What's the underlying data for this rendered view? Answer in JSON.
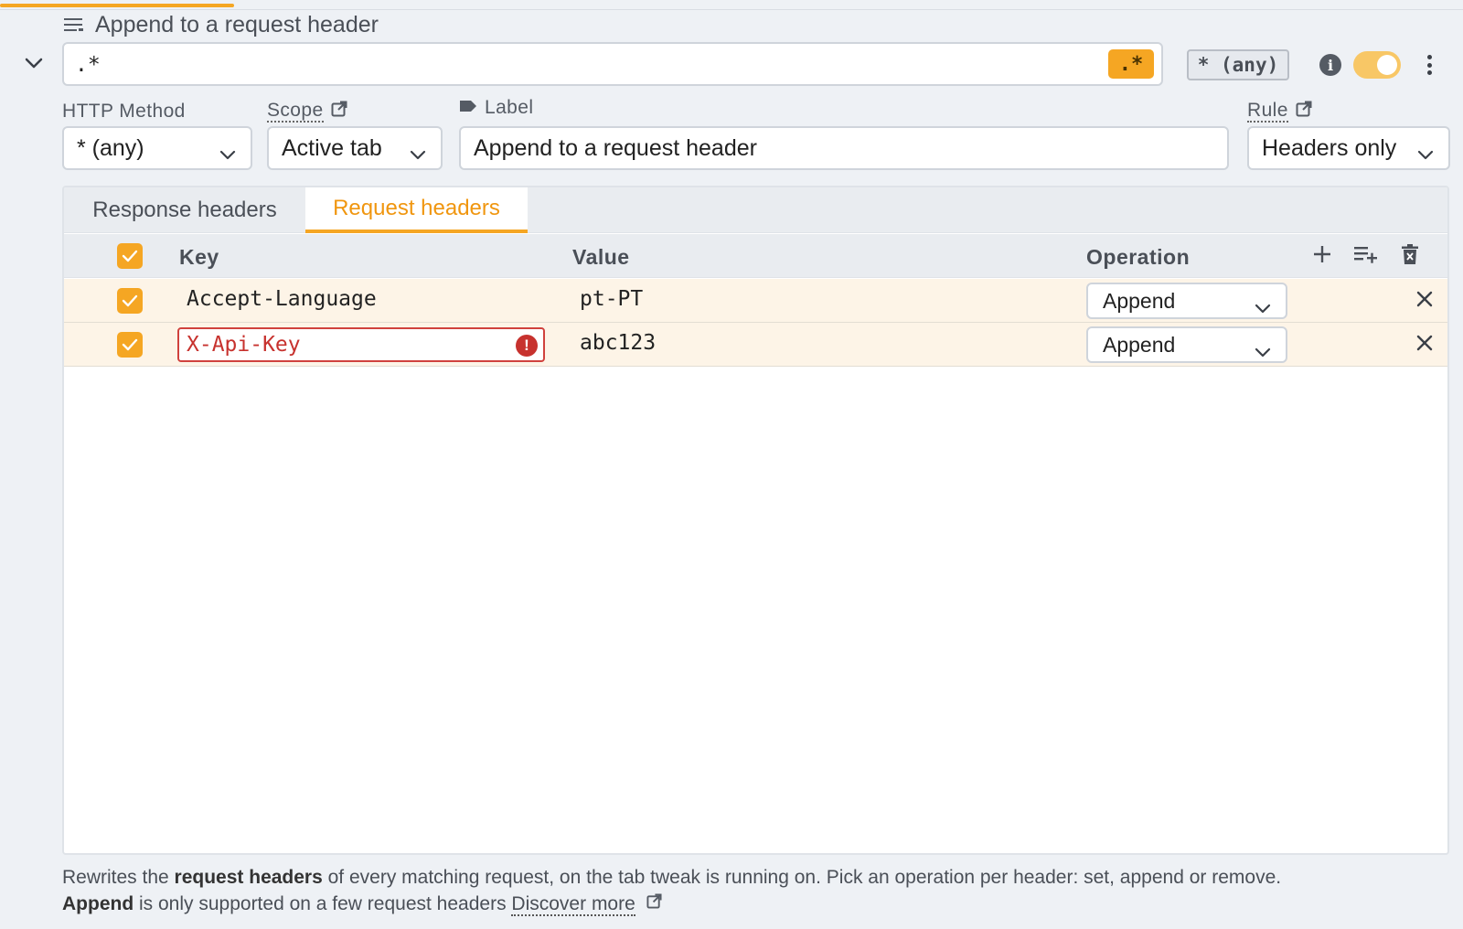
{
  "rule": {
    "title": "Append to a request header",
    "url_pattern": ".*",
    "regex_badge": ".*",
    "method_badge": "* (any)"
  },
  "fields": {
    "http_method": {
      "label": "HTTP Method",
      "value": "* (any)"
    },
    "scope": {
      "label": "Scope",
      "value": "Active tab"
    },
    "label": {
      "label": "Label",
      "value": "Append to a request header"
    },
    "rule_type": {
      "label": "Rule",
      "value": "Headers only"
    }
  },
  "tabs": [
    {
      "label": "Response headers",
      "active": false
    },
    {
      "label": "Request headers",
      "active": true
    }
  ],
  "table": {
    "columns": [
      "Key",
      "Value",
      "Operation"
    ],
    "rows": [
      {
        "checked": true,
        "key": "Accept-Language",
        "value": "pt-PT",
        "operation": "Append",
        "error": false
      },
      {
        "checked": true,
        "key": "X-Api-Key",
        "value": "abc123",
        "operation": "Append",
        "error": true
      }
    ]
  },
  "footer": {
    "p1": "Rewrites the ",
    "b1": "request headers",
    "p2": " of every matching request, on the tab tweak is running on. Pick an operation per header: set, append or remove.",
    "b2": "Append",
    "p3": " is only supported on a few request headers ",
    "link": "Discover more"
  },
  "colors": {
    "accent": "#f5a623",
    "error": "#c7322e",
    "row_bg": "#fdf4e7"
  },
  "icons": {
    "title": "list-lines-icon",
    "collapse": "chevron-down-icon",
    "info": "info-icon",
    "more": "kebab-icon",
    "external": "external-link-icon",
    "label": "tag-icon",
    "add": "plus-icon",
    "bulk": "playlist-add-icon",
    "clear": "trash-icon",
    "remove": "close-icon",
    "error": "exclamation-icon"
  }
}
